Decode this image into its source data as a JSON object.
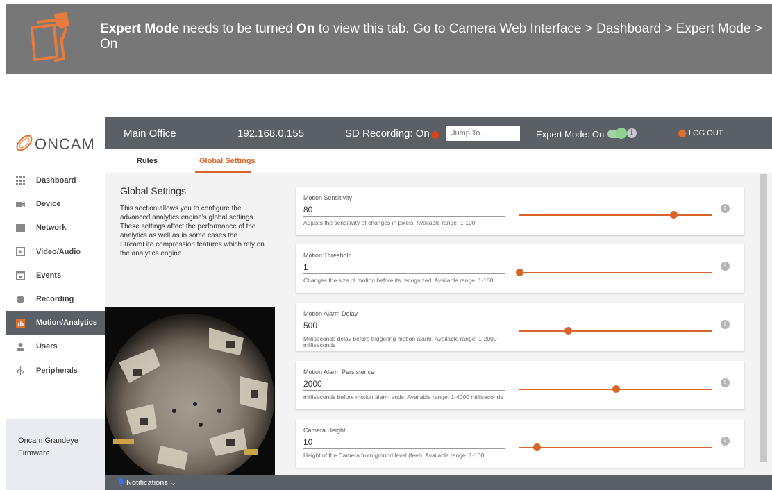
{
  "banner": {
    "mode_bold": "Expert Mode",
    "text1": " needs to be turned ",
    "on_bold": "On",
    "text2": " to view this tab. Go to Camera Web Interface > Dashboard > Expert Mode > On"
  },
  "brand": {
    "logo_text": "ONCAM"
  },
  "sidebar": {
    "items": [
      {
        "label": "Dashboard",
        "icon": "grid-icon"
      },
      {
        "label": "Device",
        "icon": "camera-icon"
      },
      {
        "label": "Network",
        "icon": "network-icon"
      },
      {
        "label": "Video/Audio",
        "icon": "play-icon"
      },
      {
        "label": "Events",
        "icon": "calendar-icon"
      },
      {
        "label": "Recording",
        "icon": "record-icon"
      },
      {
        "label": "Motion/Analytics",
        "icon": "analytics-icon"
      },
      {
        "label": "Users",
        "icon": "user-icon"
      },
      {
        "label": "Peripherals",
        "icon": "usb-icon"
      }
    ],
    "active_index": 6,
    "firmware_label": "Oncam Grandeye Firmware"
  },
  "header": {
    "site": "Main Office",
    "ip": "192.168.0.155",
    "sd_recording": "SD Recording: On",
    "jump_placeholder": "Jump To ...",
    "expert_mode": "Expert Mode: On",
    "logout": "LOG OUT"
  },
  "tabs": [
    {
      "label": "Rules",
      "active": false
    },
    {
      "label": "Global Settings",
      "active": true
    }
  ],
  "global": {
    "title": "Global Settings",
    "description": "This section allows you to configure the advanced analytics engine's global settings. These settings affect the performance of the analytics as well as in some cases the StreamLite compression features which rely on the analytics engine."
  },
  "settings": [
    {
      "label": "Motion Sensitivity",
      "value": "80",
      "help": "Adjusts the sensitivity of changes in pixels. Available range: 1-100",
      "slider_fraction": 0.8
    },
    {
      "label": "Motion Threshold",
      "value": "1",
      "help": "Changes the size of motion before its recognized. Available range: 1-100",
      "slider_fraction": 0.0
    },
    {
      "label": "Motion Alarm Delay",
      "value": "500",
      "help": "Milliseconds delay before triggering motion alarm. Available range: 1-2000 milliseconds",
      "slider_fraction": 0.25
    },
    {
      "label": "Motion Alarm Persistence",
      "value": "2000",
      "help": "milliseconds before motion alarm ends. Available range: 1-4000 milliseconds",
      "slider_fraction": 0.5
    },
    {
      "label": "Camera Height",
      "value": "10",
      "help": "Height of the Camera from ground level (feet). Available range: 1-100",
      "slider_fraction": 0.09
    }
  ],
  "footer": {
    "notifications": "Notifications"
  },
  "colors": {
    "accent": "#d9642a",
    "header_bg": "#5b5f66",
    "banner_bg": "#777777"
  }
}
